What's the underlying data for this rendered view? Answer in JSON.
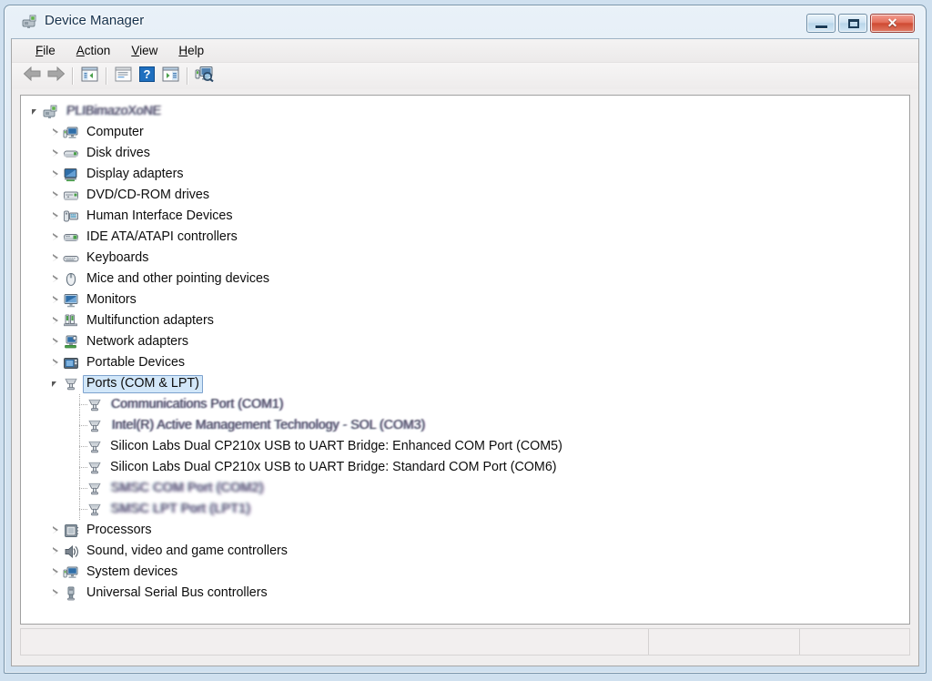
{
  "window": {
    "title": "Device Manager",
    "title_icon": "device-manager-icon",
    "caption_buttons": [
      {
        "name": "minimize-button",
        "glyph": "minimize-icon",
        "label": "Minimize"
      },
      {
        "name": "maximize-button",
        "glyph": "maximize-icon",
        "label": "Maximize"
      },
      {
        "name": "close-button",
        "glyph": "close-icon",
        "label": "✕"
      }
    ],
    "frame_color": "#7a95aa",
    "close_color": "#cf4a32"
  },
  "menu": {
    "items": [
      {
        "name": "menu-file",
        "accel": "F",
        "rest": "ile",
        "label": "File"
      },
      {
        "name": "menu-action",
        "accel": "A",
        "rest": "ction",
        "label": "Action"
      },
      {
        "name": "menu-view",
        "accel": "V",
        "rest": "iew",
        "label": "View"
      },
      {
        "name": "menu-help",
        "accel": "H",
        "rest": "elp",
        "label": "Help"
      }
    ]
  },
  "toolbar": {
    "buttons": [
      {
        "name": "back-button",
        "icon": "back-arrow-icon",
        "tooltip": "Back"
      },
      {
        "name": "forward-button",
        "icon": "forward-arrow-icon",
        "tooltip": "Forward"
      },
      {
        "name": "separator-1",
        "icon": "separator",
        "tooltip": ""
      },
      {
        "name": "show-hide-console-tree-button",
        "icon": "console-tree-icon",
        "tooltip": "Show/Hide Console Tree"
      },
      {
        "name": "separator-2",
        "icon": "separator",
        "tooltip": ""
      },
      {
        "name": "properties-button",
        "icon": "properties-icon",
        "tooltip": "Properties"
      },
      {
        "name": "help-button",
        "icon": "help-question-icon",
        "tooltip": "Help"
      },
      {
        "name": "update-driver-button",
        "icon": "update-driver-icon",
        "tooltip": "Update Driver Software"
      },
      {
        "name": "separator-3",
        "icon": "separator",
        "tooltip": ""
      },
      {
        "name": "scan-for-hardware-changes-button",
        "icon": "scan-hardware-icon",
        "tooltip": "Scan for hardware changes"
      }
    ]
  },
  "tree": {
    "root": {
      "name": "tree-root-computer",
      "label": "PLIBimazoXoNE",
      "icon": "computer-root-icon",
      "state": "expanded",
      "obfuscated": true
    },
    "items": [
      {
        "name": "tree-item-computer",
        "label": "Computer",
        "icon": "computer-icon",
        "state": "collapsed",
        "depth": 1
      },
      {
        "name": "tree-item-disk-drives",
        "label": "Disk drives",
        "icon": "disk-drive-icon",
        "state": "collapsed",
        "depth": 1
      },
      {
        "name": "tree-item-display-adapters",
        "label": "Display adapters",
        "icon": "display-adapter-icon",
        "state": "collapsed",
        "depth": 1
      },
      {
        "name": "tree-item-dvd-cd-rom-drives",
        "label": "DVD/CD-ROM drives",
        "icon": "dvd-drive-icon",
        "state": "collapsed",
        "depth": 1
      },
      {
        "name": "tree-item-human-interface-devices",
        "label": "Human Interface Devices",
        "icon": "hid-icon",
        "state": "collapsed",
        "depth": 1
      },
      {
        "name": "tree-item-ide-ata-atapi-controllers",
        "label": "IDE ATA/ATAPI controllers",
        "icon": "ide-controller-icon",
        "state": "collapsed",
        "depth": 1
      },
      {
        "name": "tree-item-keyboards",
        "label": "Keyboards",
        "icon": "keyboard-icon",
        "state": "collapsed",
        "depth": 1
      },
      {
        "name": "tree-item-mice-and-other-pointing-devices",
        "label": "Mice and other pointing devices",
        "icon": "mouse-icon",
        "state": "collapsed",
        "depth": 1
      },
      {
        "name": "tree-item-monitors",
        "label": "Monitors",
        "icon": "monitor-icon",
        "state": "collapsed",
        "depth": 1
      },
      {
        "name": "tree-item-multifunction-adapters",
        "label": "Multifunction adapters",
        "icon": "multifunction-adapter-icon",
        "state": "collapsed",
        "depth": 1
      },
      {
        "name": "tree-item-network-adapters",
        "label": "Network adapters",
        "icon": "network-adapter-icon",
        "state": "collapsed",
        "depth": 1
      },
      {
        "name": "tree-item-portable-devices",
        "label": "Portable Devices",
        "icon": "portable-device-icon",
        "state": "collapsed",
        "depth": 1
      },
      {
        "name": "tree-item-ports-com-and-lpt",
        "label": "Ports (COM & LPT)",
        "icon": "port-icon",
        "state": "expanded",
        "depth": 1,
        "selected": true
      },
      {
        "name": "tree-item-communications-port-com1",
        "label": "Communications Port (COM1)",
        "icon": "port-icon",
        "state": "leaf",
        "depth": 2,
        "obfuscated": true
      },
      {
        "name": "tree-item-intel-active-management-technology-sol-com3",
        "label": "Intel(R) Active Management Technology - SOL (COM3)",
        "icon": "port-icon",
        "state": "leaf",
        "depth": 2,
        "obfuscated": true
      },
      {
        "name": "tree-item-silicon-labs-enhanced-com-port-com5",
        "label": "Silicon Labs Dual CP210x USB to UART Bridge: Enhanced COM Port (COM5)",
        "icon": "port-icon",
        "state": "leaf",
        "depth": 2
      },
      {
        "name": "tree-item-silicon-labs-standard-com-port-com6",
        "label": "Silicon Labs Dual CP210x USB to UART Bridge: Standard COM Port (COM6)",
        "icon": "port-icon",
        "state": "leaf",
        "depth": 2
      },
      {
        "name": "tree-item-smsc-com-port-com2",
        "label": "SMSC COM Port (COM2)",
        "icon": "port-icon",
        "state": "leaf",
        "depth": 2,
        "obfuscated": true,
        "obfuscated_heavy": true
      },
      {
        "name": "tree-item-smsc-lpt-port-lpt1",
        "label": "SMSC LPT Port (LPT1)",
        "icon": "port-icon",
        "state": "leaf",
        "depth": 2,
        "obfuscated": true,
        "obfuscated_heavy": true
      },
      {
        "name": "tree-item-processors",
        "label": "Processors",
        "icon": "processor-icon",
        "state": "collapsed",
        "depth": 1
      },
      {
        "name": "tree-item-sound-video-and-game-controllers",
        "label": "Sound, video and game controllers",
        "icon": "sound-icon",
        "state": "collapsed",
        "depth": 1
      },
      {
        "name": "tree-item-system-devices",
        "label": "System devices",
        "icon": "system-device-icon",
        "state": "collapsed",
        "depth": 1
      },
      {
        "name": "tree-item-universal-serial-bus-controllers",
        "label": "Universal Serial Bus controllers",
        "icon": "usb-icon",
        "state": "collapsed",
        "depth": 1
      }
    ]
  },
  "status_bar": {
    "panes": [
      {
        "name": "status-pane-message",
        "text": ""
      },
      {
        "name": "status-pane-secondary",
        "text": ""
      },
      {
        "name": "status-pane-tertiary",
        "text": ""
      }
    ]
  }
}
